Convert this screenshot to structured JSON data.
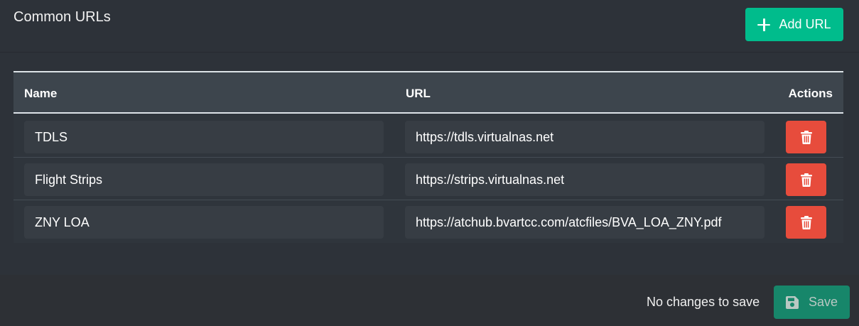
{
  "header": {
    "title": "Common URLs",
    "add_button_label": "Add URL"
  },
  "table": {
    "columns": {
      "name": "Name",
      "url": "URL",
      "actions": "Actions"
    },
    "rows": [
      {
        "name": "TDLS",
        "url": "https://tdls.virtualnas.net"
      },
      {
        "name": "Flight Strips",
        "url": "https://strips.virtualnas.net"
      },
      {
        "name": "ZNY LOA",
        "url": "https://atchub.bvartcc.com/atcfiles/BVA_LOA_ZNY.pdf"
      }
    ]
  },
  "footer": {
    "status_text": "No changes to save",
    "save_label": "Save"
  },
  "icons": {
    "add": "plus-icon",
    "delete": "trash-icon",
    "save": "floppy-disk-icon"
  },
  "colors": {
    "success": "#00bc8c",
    "danger": "#e74c3c",
    "save_disabled": "#17866a"
  }
}
